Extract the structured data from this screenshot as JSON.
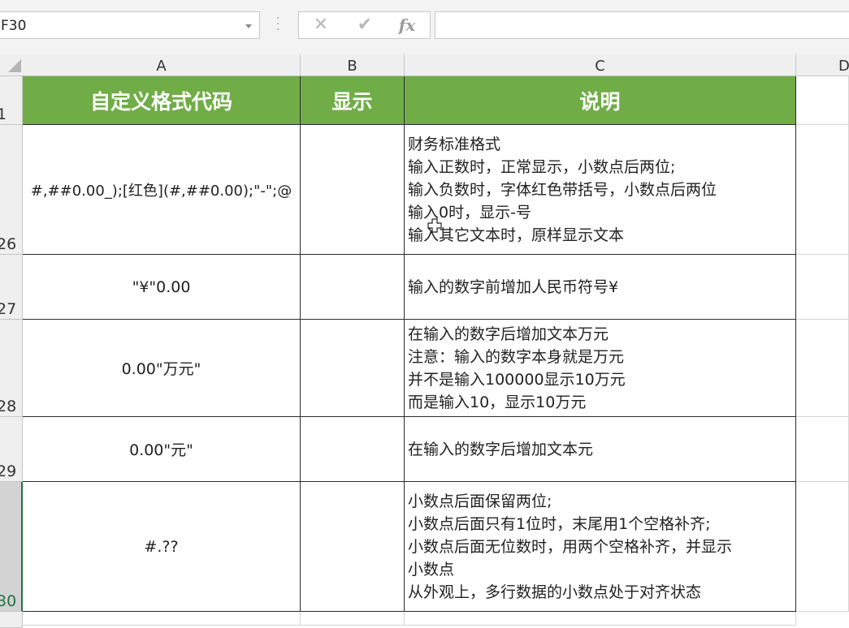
{
  "formula_bar": {
    "name_box": "F30",
    "cancel_symbol": "✕",
    "enter_symbol": "✔",
    "fx_label": "fx",
    "formula": ""
  },
  "columns": [
    "A",
    "B",
    "C",
    "D"
  ],
  "rows": [
    "1",
    "26",
    "27",
    "28",
    "29",
    "30"
  ],
  "table": {
    "headers": [
      "自定义格式代码",
      "显示",
      "说明"
    ],
    "rows": [
      {
        "code": "#,##0.00_);[红色](#,##0.00);\"-\";@",
        "display": "",
        "desc": [
          "财务标准格式",
          "输入正数时，正常显示，小数点后两位;",
          "输入负数时，字体红色带括号，小数点后两位",
          "输入0时，显示-号",
          "输入其它文本时，原样显示文本"
        ]
      },
      {
        "code": "\"¥\"0.00",
        "display": "",
        "desc": [
          "输入的数字前增加人民币符号¥"
        ]
      },
      {
        "code": "0.00\"万元\"",
        "display": "",
        "desc": [
          "在输入的数字后增加文本万元",
          "注意：输入的数字本身就是万元",
          "并不是输入100000显示10万元",
          "而是输入10，显示10万元"
        ]
      },
      {
        "code": "0.00\"元\"",
        "display": "",
        "desc": [
          "在输入的数字后增加文本元"
        ]
      },
      {
        "code": "#.??",
        "display": "",
        "desc": [
          "小数点后面保留两位;",
          "小数点后面只有1位时，末尾用1个空格补齐;",
          "小数点后面无位数时，用两个空格补齐，并显示",
          "小数点",
          "从外观上，多行数据的小数点处于对齐状态"
        ]
      }
    ]
  },
  "colors": {
    "header_fill": "#70ad47",
    "header_text": "#ffffff",
    "selection": "#217346"
  }
}
